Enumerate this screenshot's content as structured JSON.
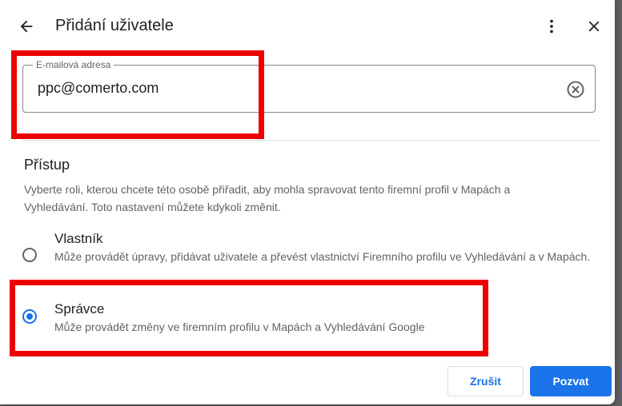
{
  "dialog": {
    "title": "Přidání uživatele",
    "back_icon": "arrow-back-icon",
    "more_icon": "more-vert-icon",
    "close_icon": "close-icon"
  },
  "email_field": {
    "label": "E-mailová adresa",
    "value": "ppc@comerto.com",
    "clear_icon": "clear-circle-icon"
  },
  "access": {
    "title": "Přístup",
    "description": "Vyberte roli, kterou chcete této osobě přiřadit, aby mohla spravovat tento firemní profil v Mapách a Vyhledávání. Toto nastavení můžete kdykoli změnit.",
    "options": [
      {
        "label": "Vlastník",
        "description": "Může provádět úpravy, přidávat uživatele a převést vlastnictví Firemního profilu ve Vyhledávání a v Mapách.",
        "selected": false
      },
      {
        "label": "Správce",
        "description": "Může provádět změny ve firemním profilu v Mapách a Vyhledávání Google",
        "selected": true
      }
    ]
  },
  "buttons": {
    "cancel": "Zrušit",
    "invite": "Pozvat"
  },
  "colors": {
    "accent": "#1a73e8",
    "highlight": "#ee0000"
  }
}
